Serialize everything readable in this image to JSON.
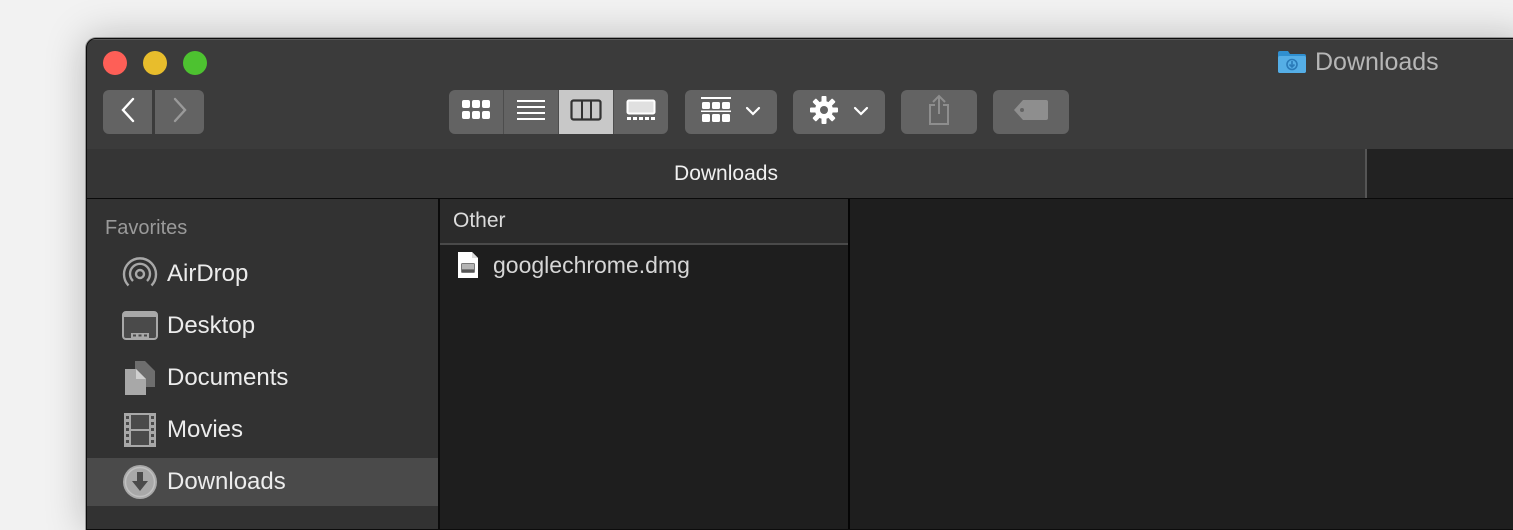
{
  "window": {
    "title": "Downloads",
    "title_icon": "downloads-folder-icon",
    "traffic_lights": {
      "close_color": "#fe5f57",
      "minimize_color": "#e8bd2c",
      "maximize_color": "#4dc230"
    }
  },
  "toolbar": {
    "back_icon": "chevron-left-icon",
    "forward_icon": "chevron-right-icon",
    "view_modes": [
      {
        "name": "icon-view",
        "icon": "grid-icon",
        "active": false
      },
      {
        "name": "list-view",
        "icon": "list-icon",
        "active": false
      },
      {
        "name": "column-view",
        "icon": "columns-icon",
        "active": true
      },
      {
        "name": "gallery-view",
        "icon": "gallery-icon",
        "active": false
      }
    ],
    "group_icon": "group-by-icon",
    "action_icon": "gear-icon",
    "share_icon": "share-icon",
    "tag_icon": "tag-icon"
  },
  "pathbar": {
    "title": "Downloads"
  },
  "sidebar": {
    "heading": "Favorites",
    "items": [
      {
        "label": "AirDrop",
        "icon": "airdrop-icon",
        "selected": false
      },
      {
        "label": "Desktop",
        "icon": "desktop-icon",
        "selected": false
      },
      {
        "label": "Documents",
        "icon": "documents-icon",
        "selected": false
      },
      {
        "label": "Movies",
        "icon": "movies-icon",
        "selected": false
      },
      {
        "label": "Downloads",
        "icon": "downloads-icon",
        "selected": true
      }
    ]
  },
  "column": {
    "header": "Other",
    "files": [
      {
        "name": "googlechrome.dmg",
        "icon": "disk-image-icon"
      }
    ]
  }
}
